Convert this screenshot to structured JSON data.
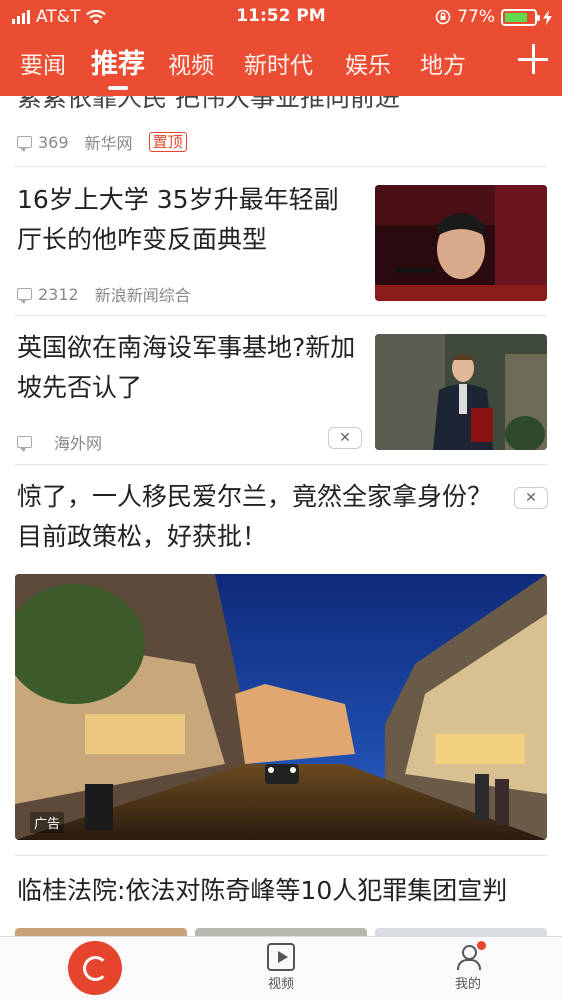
{
  "status_bar": {
    "carrier": "AT&T",
    "time": "11:52 PM",
    "battery": "77%",
    "battery_level": 0.77
  },
  "tabs": [
    "要闻",
    "推荐",
    "视频",
    "新时代",
    "娱乐",
    "地方"
  ],
  "active_tab_index": 1,
  "feed": [
    {
      "title": "紧紧依靠人民 把伟大事业推向前进",
      "comments": "369",
      "source": "新华网",
      "tag": "置顶"
    },
    {
      "title": "16岁上大学 35岁升最年轻副厅长的他咋变反面典型",
      "comments": "2312",
      "source": "新浪新闻综合"
    },
    {
      "title": "英国欲在南海设军事基地?新加坡先否认了",
      "comments": "",
      "source": "海外网"
    },
    {
      "title": "惊了，一人移民爱尔兰，竟然全家拿身份？目前政策松，好获批！",
      "ad_label": "广告"
    },
    {
      "title": "临桂法院:依法对陈奇峰等10人犯罪集团宣判"
    }
  ],
  "bottom_nav": {
    "video": "视频",
    "me": "我的"
  },
  "colors": {
    "brand": "#ea4d31",
    "accent": "#e6452d"
  }
}
